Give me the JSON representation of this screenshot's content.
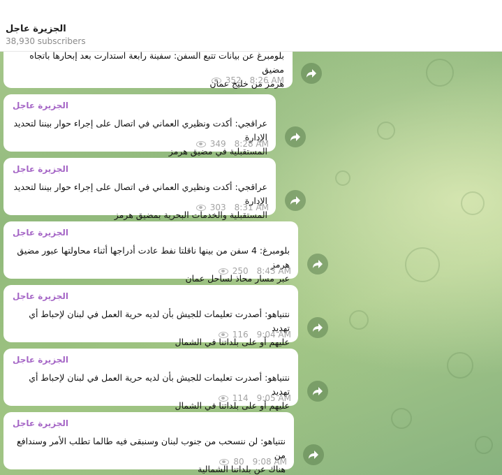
{
  "channel": {
    "title": "الجزيرة عاجل",
    "subscribers": "38,930 subscribers"
  },
  "messages": [
    {
      "sender": "",
      "lines": [
        "بلومبرغ عن بيانات تتبع السفن: سفينة رابعة استدارت بعد إبحارها باتجاه مضيق",
        "هرمز من خليج عمان"
      ],
      "views": "352",
      "time": "8:26 AM"
    },
    {
      "sender": "الجزيرة عاجل",
      "lines": [
        "عراقجي: أكدت ونظيري العماني في اتصال على إجراء حوار بيننا لتحديد الإدارة",
        "المستقبلية في مضيق هرمز"
      ],
      "views": "349",
      "time": "8:28 AM"
    },
    {
      "sender": "الجزيرة عاجل",
      "lines": [
        "عراقجي: أكدت ونظيري العماني في اتصال على إجراء حوار بيننا لتحديد الإدارة",
        "المستقبلية والخدمات البحرية بمضيق هرمز"
      ],
      "views": "303",
      "time": "8:31 AM"
    },
    {
      "sender": "الجزيرة عاجل",
      "lines": [
        "بلومبرغ: 4 سفن من بينها ناقلتا نفط عادت أدراجها أثناء محاولتها عبور مضيق هرمز",
        "عبر مسار محاذ لساحل عمان"
      ],
      "views": "250",
      "time": "8:43 AM"
    },
    {
      "sender": "الجزيرة عاجل",
      "lines": [
        "نتنياهو: أصدرت تعليمات للجيش بأن لديه حرية العمل في لبنان  لإحباط أي تهديد",
        "عليهم أو على بلداتنا في الشمال"
      ],
      "views": "116",
      "time": "9:04 AM"
    },
    {
      "sender": "الجزيرة عاجل",
      "lines": [
        "نتنياهو: أصدرت تعليمات للجيش بأن لديه حرية العمل في لبنان  لإحباط أي تهديد",
        "عليهم أو على بلداتنا في الشمال"
      ],
      "views": "114",
      "time": "9:05 AM"
    },
    {
      "sender": "الجزيرة عاجل",
      "lines": [
        "نتنياهو: لن ننسحب من جنوب لبنان وسنبقى فيه طالما تطلب الأمر وسندافع من",
        "هناك عن بلداتنا الشمالية"
      ],
      "views": "80",
      "time": "9:08 AM"
    }
  ]
}
